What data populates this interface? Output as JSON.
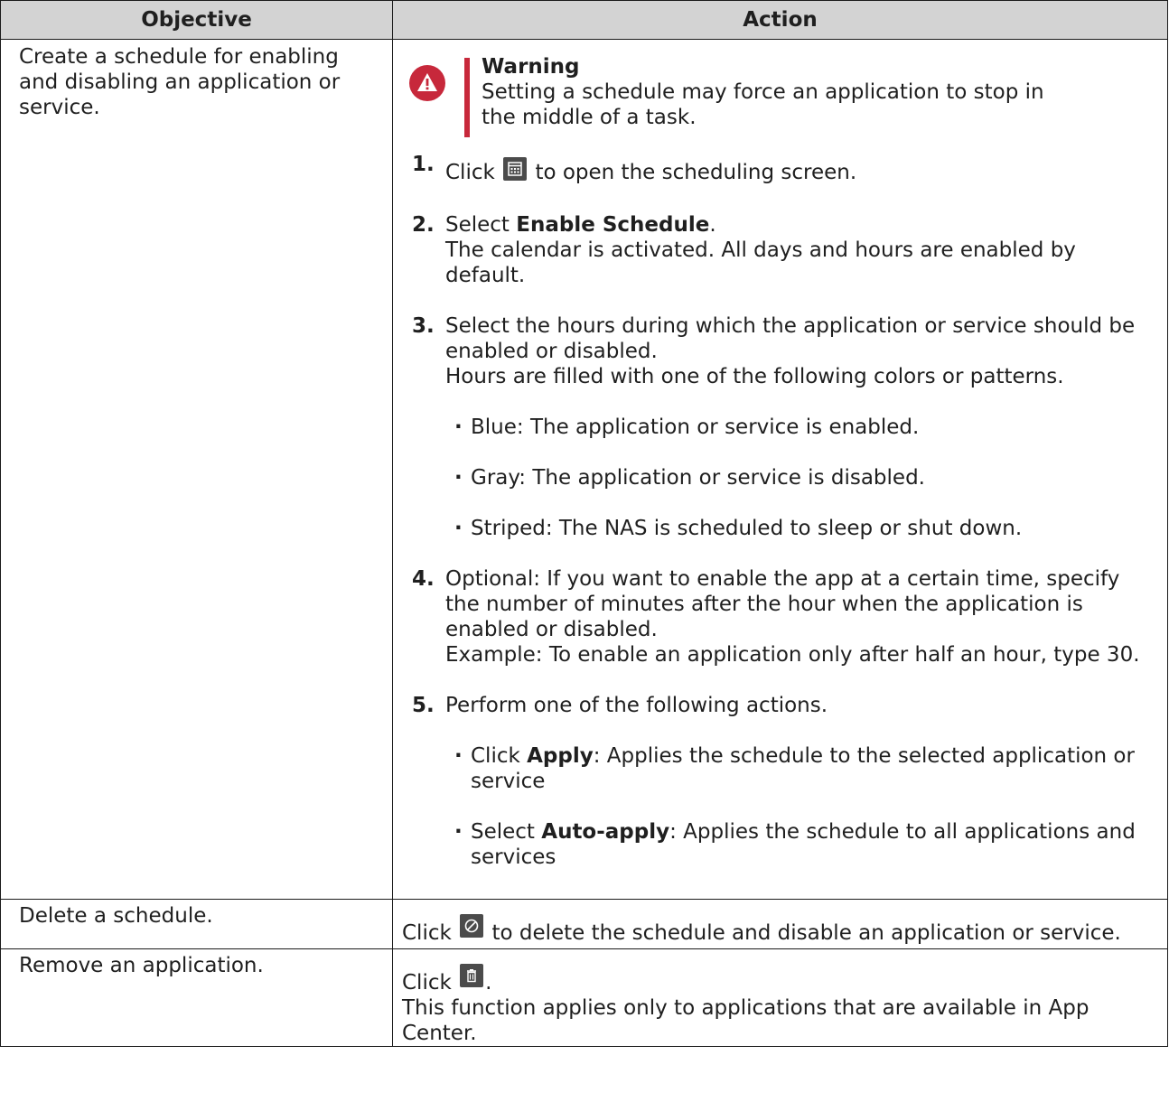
{
  "table": {
    "header_objective": "Objective",
    "header_action": "Action"
  },
  "row1": {
    "objective": "Create a schedule for enabling and disabling an application or service.",
    "warning": {
      "title": "Warning",
      "text": "Setting a schedule may force an application to stop in the middle of a task.",
      "icon": "warning-triangle-icon",
      "color": "#c7283b"
    },
    "step1": {
      "num": "1.",
      "pre": "Click",
      "icon": "calendar-icon",
      "post": "to open the scheduling screen."
    },
    "step2": {
      "num": "2.",
      "pre": "Select ",
      "bold": "Enable Schedule",
      "post": ".",
      "line2": "The calendar is activated. All days and hours are enabled by default."
    },
    "step3": {
      "num": "3.",
      "text": "Select the hours during which the application or service should be enabled or disabled.",
      "line2": "Hours are filled with one of the following colors or patterns."
    },
    "step3_bullets": [
      "Blue: The application or service is enabled.",
      "Gray: The application or service is disabled.",
      "Striped: The NAS is scheduled to sleep or shut down."
    ],
    "step4": {
      "num": "4.",
      "text": "Optional: If you want to enable the app at a certain time, specify the number of minutes after the hour when the application is enabled or disabled.",
      "line2": "Example: To enable an application only after half an hour, type 30."
    },
    "step5": {
      "num": "5.",
      "text": "Perform one of the following actions."
    },
    "step5_bullets": [
      {
        "pre": "Click ",
        "bold": "Apply",
        "post": ": Applies the schedule to the selected application or service"
      },
      {
        "pre": "Select ",
        "bold": "Auto-apply",
        "post": ": Applies the schedule to all applications and services"
      }
    ]
  },
  "row2": {
    "objective": "Delete a schedule.",
    "pre": "Click",
    "icon": "clear-schedule-icon",
    "post": "to delete the schedule and disable an application or service."
  },
  "row3": {
    "objective": "Remove an application.",
    "pre": "Click",
    "icon": "trash-icon",
    "post": ".",
    "line2": "This function applies only to applications that are available in App Center."
  }
}
